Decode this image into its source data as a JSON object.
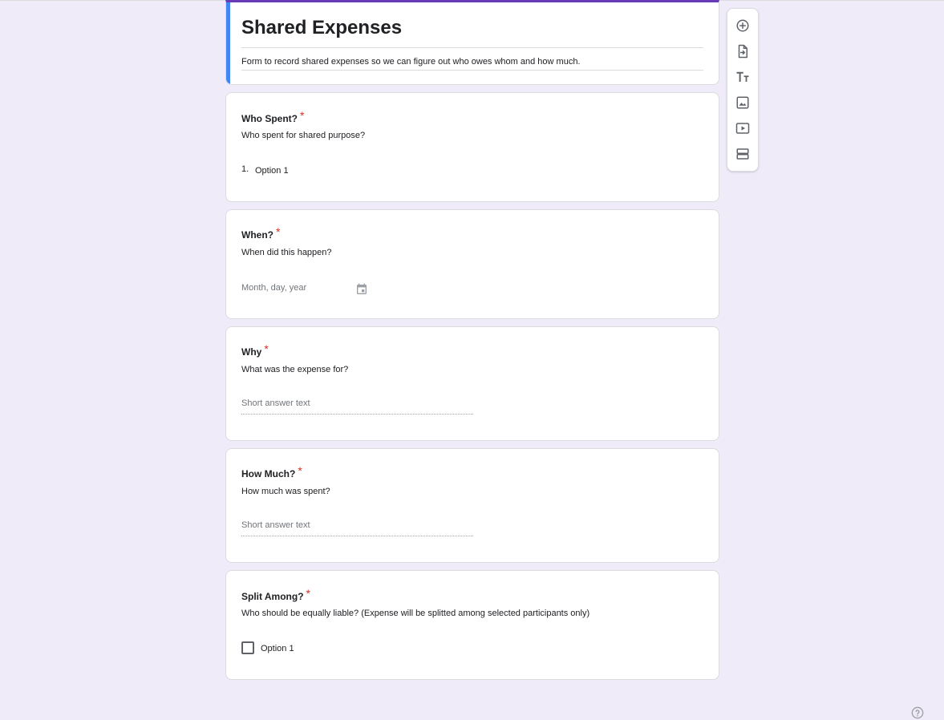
{
  "form": {
    "title": "Shared Expenses",
    "description": "Form to record shared expenses so we can figure out who owes whom and how much."
  },
  "questions": [
    {
      "title": "Who Spent?",
      "required_mark": "*",
      "description": "Who spent for shared purpose?",
      "type": "dropdown",
      "option_number": "1.",
      "option_label": "Option 1"
    },
    {
      "title": "When?",
      "required_mark": "*",
      "description": "When did this happen?",
      "type": "date",
      "placeholder": "Month, day, year"
    },
    {
      "title": "Why",
      "required_mark": "*",
      "description": "What was the expense for?",
      "type": "short_answer",
      "placeholder": "Short answer text"
    },
    {
      "title": "How Much?",
      "required_mark": "*",
      "description": "How much was spent?",
      "type": "short_answer",
      "placeholder": "Short answer text"
    },
    {
      "title": "Split Among?",
      "required_mark": "*",
      "description": "Who should be equally liable? (Expense will be splitted among selected participants only)",
      "type": "checkboxes",
      "option_label": "Option 1"
    }
  ],
  "toolbar": {
    "items": [
      "add-question-icon",
      "import-questions-icon",
      "add-title-icon",
      "add-image-icon",
      "add-video-icon",
      "add-section-icon"
    ]
  },
  "colors": {
    "background": "#f0ebf8",
    "theme": "#673ab7",
    "accent": "#4285f4",
    "required": "#d93025"
  },
  "help": {
    "icon": "help-icon"
  }
}
